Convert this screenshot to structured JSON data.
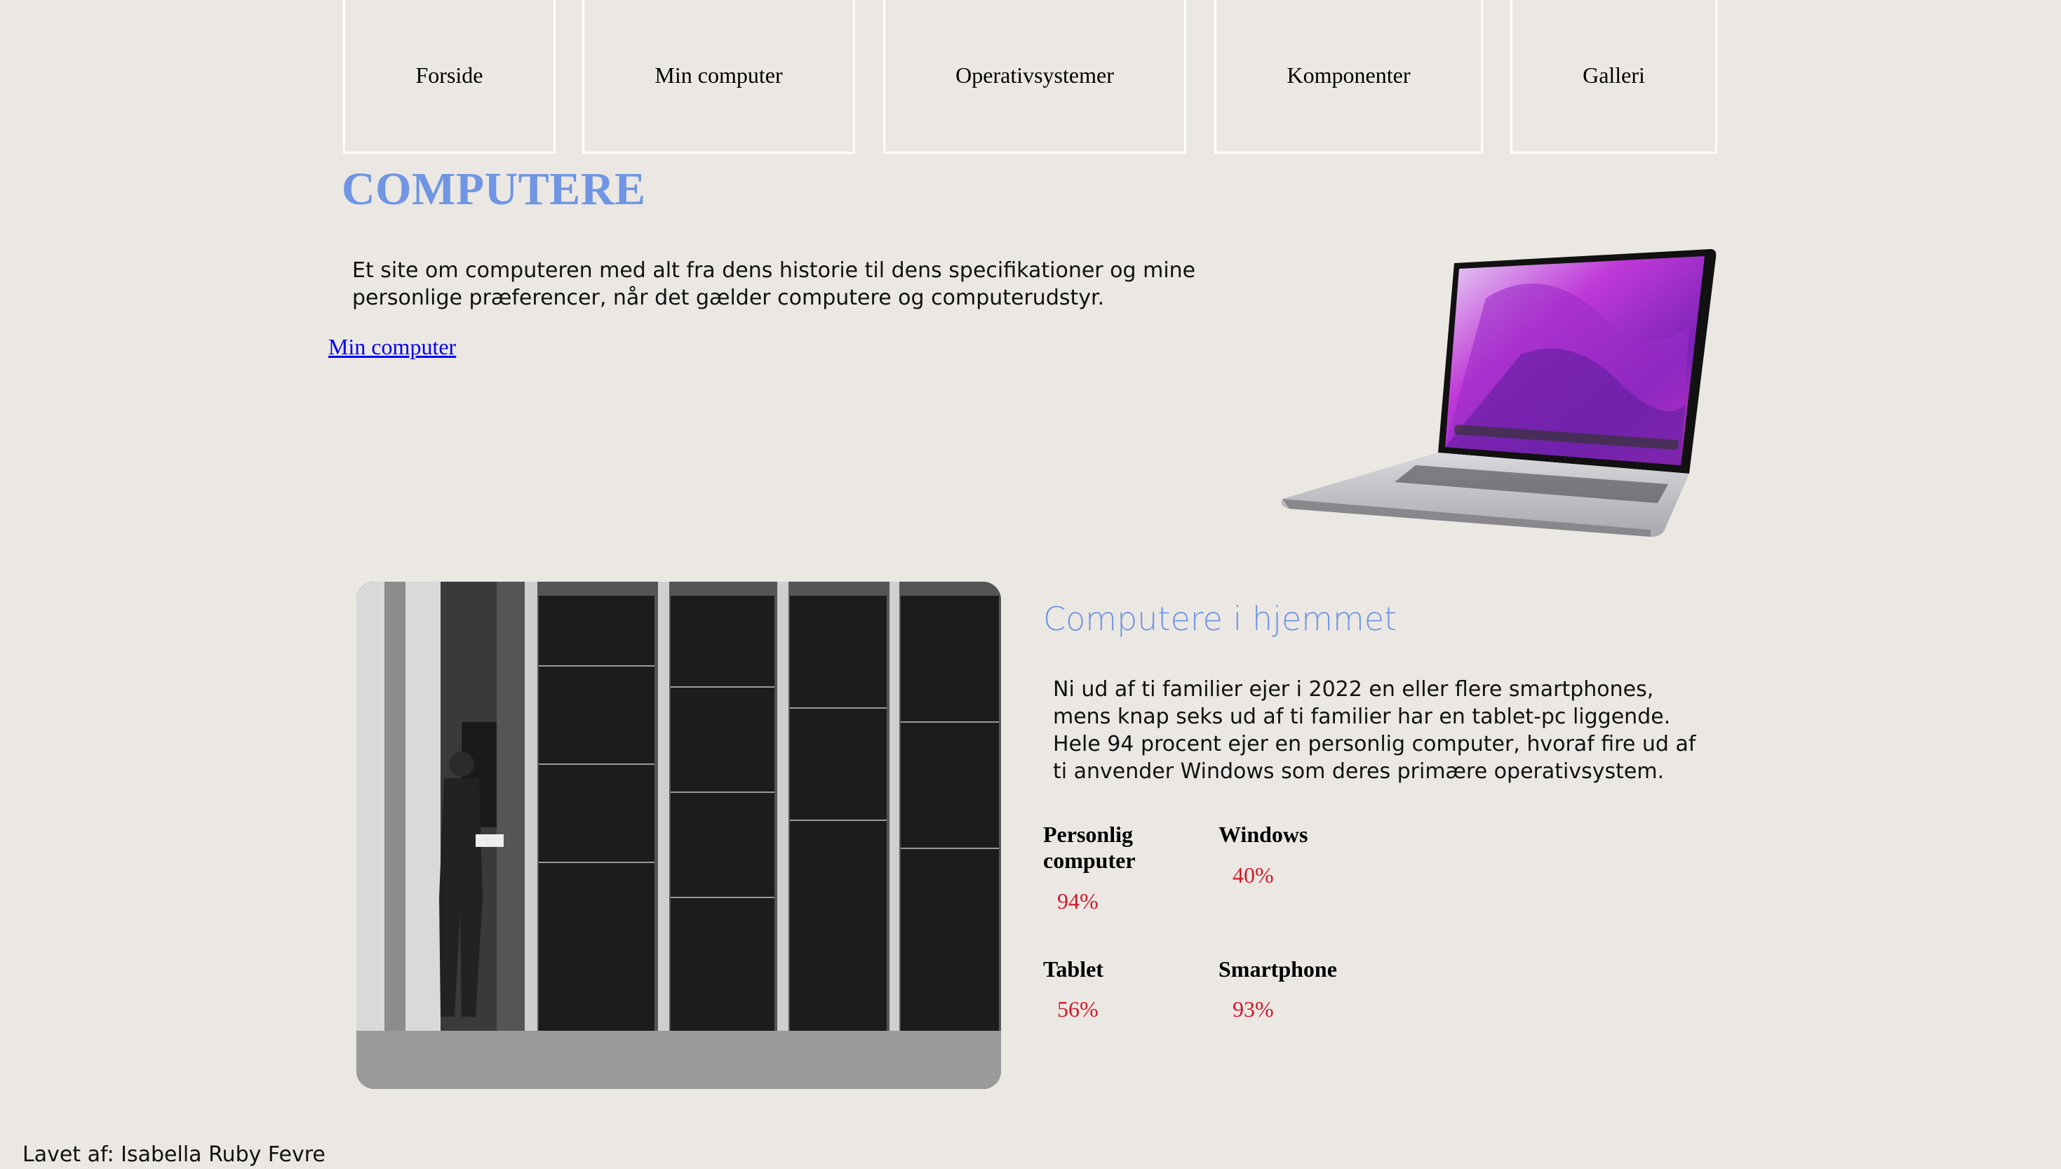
{
  "nav": {
    "items": [
      {
        "label": "Forside"
      },
      {
        "label": "Min computer"
      },
      {
        "label": "Operativsystemer"
      },
      {
        "label": "Komponenter"
      },
      {
        "label": "Galleri"
      }
    ]
  },
  "header": {
    "title": "COMPUTERE",
    "intro": "Et site om computeren med alt fra dens historie til dens specifikationer og mine personlige præferencer, når det gælder computere og computerudstyr.",
    "link_label": "Min computer"
  },
  "home_section": {
    "title": "Computere i hjemmet",
    "text": "Ni ud af ti familier ejer i 2022 en eller flere smartphones, mens knap seks ud af ti familier har en tablet-pc liggende. Hele 94 procent ejer en personlig computer, hvoraf fire ud af ti anvender Windows som deres primære operativsystem.",
    "stats": [
      {
        "label": "Personlig computer",
        "value": "94%"
      },
      {
        "label": "Windows",
        "value": "40%"
      },
      {
        "label": "Tablet",
        "value": "56%"
      },
      {
        "label": "Smartphone",
        "value": "93%"
      }
    ]
  },
  "footer": {
    "text": "Lavet af: Isabella Ruby Fevre"
  },
  "colors": {
    "background": "#ebe8e3",
    "accent": "#7095e3",
    "stat_value": "#d01a2b",
    "link": "#0000ee"
  },
  "icons": {
    "laptop": "laptop-image",
    "photo": "mainframe-photo"
  }
}
